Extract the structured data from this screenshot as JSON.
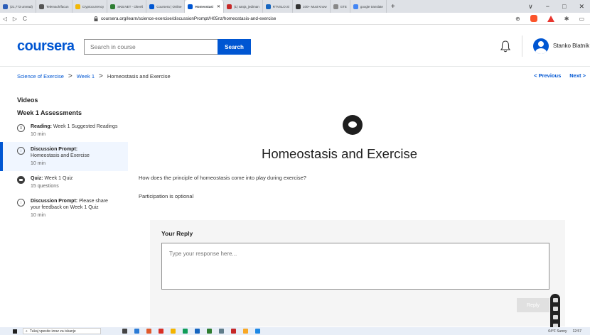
{
  "browser": {
    "tabs": [
      {
        "title": "(21,773 unread)",
        "color": "#2b5db8"
      },
      {
        "title": "Telemach/facun",
        "color": "#555555"
      },
      {
        "title": "Cryptocurrency",
        "color": "#f2b807"
      },
      {
        "title": "SKB.NET - Obveš",
        "color": "#2e7d32"
      },
      {
        "title": "Coursera | Online",
        "color": "#0056d2"
      },
      {
        "title": "Homeostasi",
        "color": "#0056d2",
        "active": true
      },
      {
        "title": "(1) sanja_jediman",
        "color": "#c62828"
      },
      {
        "title": "RTVSLO.Si",
        "color": "#1565c0"
      },
      {
        "title": "100+ Must Know",
        "color": "#333333"
      },
      {
        "title": "GTE",
        "color": "#888888"
      },
      {
        "title": "google translate",
        "color": "#4285f4"
      }
    ],
    "new_tab": "+",
    "window_controls": [
      "∨",
      "−",
      "□",
      "✕"
    ],
    "nav": {
      "back": "◁",
      "forward": "▷",
      "reload": "C"
    },
    "url": "coursera.org/learn/science-exercise/discussionPrompt/H05nz/homeostasis-and-exercise"
  },
  "header": {
    "logo": "coursera",
    "search_placeholder": "Search in course",
    "search_button": "Search",
    "username": "Stanko Blatnik"
  },
  "breadcrumb": {
    "course": "Science of Exercise",
    "week": "Week 1",
    "current": "Homeostasis and Exercise",
    "sep": ">"
  },
  "pager": {
    "previous": "< Previous",
    "next": "Next >"
  },
  "sidebar": {
    "videos": "Videos",
    "week_heading": "Week 1 Assessments",
    "items": [
      {
        "type": "Reading:",
        "title": "Week 1 Suggested Readings",
        "duration": "10 min",
        "icon": "reading-icon"
      },
      {
        "type": "Discussion Prompt:",
        "title": "Homeostasis and Exercise",
        "duration": "10 min",
        "icon": "discussion-icon",
        "active": true
      },
      {
        "type": "Quiz:",
        "title": "Week 1 Quiz",
        "duration": "15 questions",
        "icon": "quiz-icon"
      },
      {
        "type": "Discussion Prompt:",
        "title": "Please share your feedback on Week 1 Quiz",
        "duration": "10 min",
        "icon": "discussion-icon"
      }
    ]
  },
  "main": {
    "title": "Homeostasis and Exercise",
    "question": "How does the principle of homeostasis come into play during exercise?",
    "optional": "Participation is optional",
    "reply_label": "Your Reply",
    "reply_placeholder": "Type your response here...",
    "reply_button": "Reply"
  },
  "taskbar": {
    "search_placeholder": "Tukaj vpesite izraz za iskanje",
    "weather": "64°F Sunny",
    "time": "12:57"
  },
  "colors": {
    "brand": "#0056d2"
  }
}
